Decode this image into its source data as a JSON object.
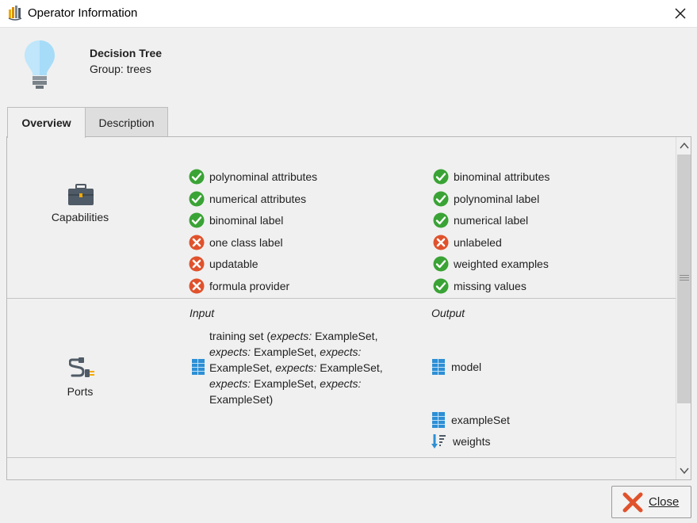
{
  "window": {
    "title": "Operator Information",
    "app_icon": "rapidminer-logo-icon",
    "close_icon": "close-icon"
  },
  "operator": {
    "name": "Decision Tree",
    "group": "Group: trees",
    "icon": "lightbulb-icon"
  },
  "tabs": [
    {
      "label": "Overview",
      "selected": true
    },
    {
      "label": "Description",
      "selected": false
    }
  ],
  "capabilities": {
    "label": "Capabilities",
    "icon": "briefcase-icon",
    "left": [
      {
        "label": "polynominal attributes",
        "supported": true
      },
      {
        "label": "numerical attributes",
        "supported": true
      },
      {
        "label": "binominal label",
        "supported": true
      },
      {
        "label": "one class label",
        "supported": false
      },
      {
        "label": "updatable",
        "supported": false
      },
      {
        "label": "formula provider",
        "supported": false
      }
    ],
    "right": [
      {
        "label": "binominal attributes",
        "supported": true
      },
      {
        "label": "polynominal label",
        "supported": true
      },
      {
        "label": "numerical label",
        "supported": true
      },
      {
        "label": "unlabeled",
        "supported": false
      },
      {
        "label": "weighted examples",
        "supported": true
      },
      {
        "label": "missing values",
        "supported": true
      }
    ]
  },
  "ports": {
    "label": "Ports",
    "icon": "plug-icon",
    "input_heading": "Input",
    "output_heading": "Output",
    "input": {
      "name": "training set",
      "expects_word": "expects:",
      "type": "ExampleSet",
      "icon": "table-icon"
    },
    "output": [
      {
        "label": "model",
        "icon": "table-icon"
      },
      {
        "label": "exampleSet",
        "icon": "table-icon"
      },
      {
        "label": "weights",
        "icon": "sort-weights-icon"
      }
    ]
  },
  "buttons": {
    "close_label": "Close"
  },
  "colors": {
    "success": "#3aa335",
    "error": "#e0522c",
    "port_blue": "#2d8fd5",
    "background": "#f0f0f0"
  }
}
